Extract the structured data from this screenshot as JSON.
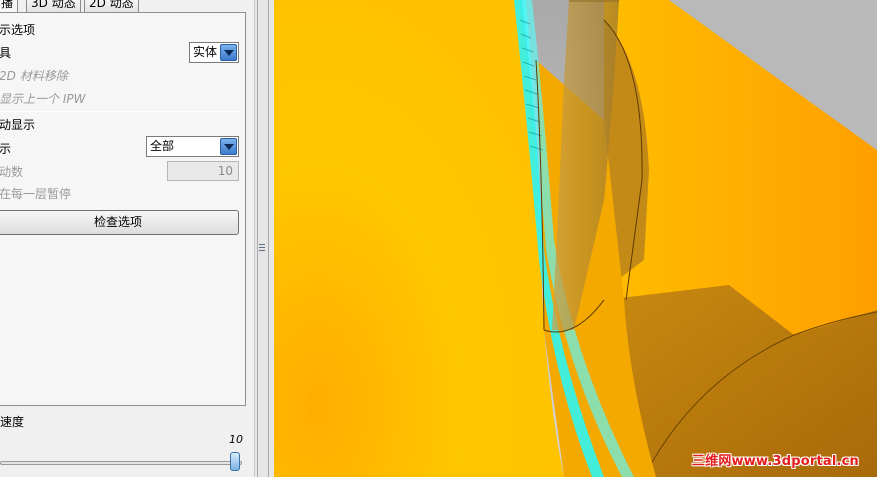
{
  "tabs": [
    "播",
    "3D 动态",
    "2D 动态"
  ],
  "display_options": {
    "section_title": "示选项",
    "tool_label": "具",
    "tool_value": "实体",
    "material_removal": "2D 材料移除",
    "show_prev_ipw": "显示上一个 IPW"
  },
  "motion_display": {
    "section_title": "动显示",
    "display_label": "示",
    "display_value": "全部",
    "count_label": "动数",
    "count_value": "10",
    "pause_each_layer": "在每一层暂停"
  },
  "check_options_button": "检查选项",
  "animation_speed": {
    "label": "速度",
    "value": "10",
    "level": 1.0
  },
  "watermark": "三维网www.3dportal.cn",
  "colors": {
    "part_orange": "#ffb300",
    "part_dark": "#b8780a",
    "tool_path_cyan": "#2ff4f2",
    "background_gray": "#c2c2c2"
  }
}
